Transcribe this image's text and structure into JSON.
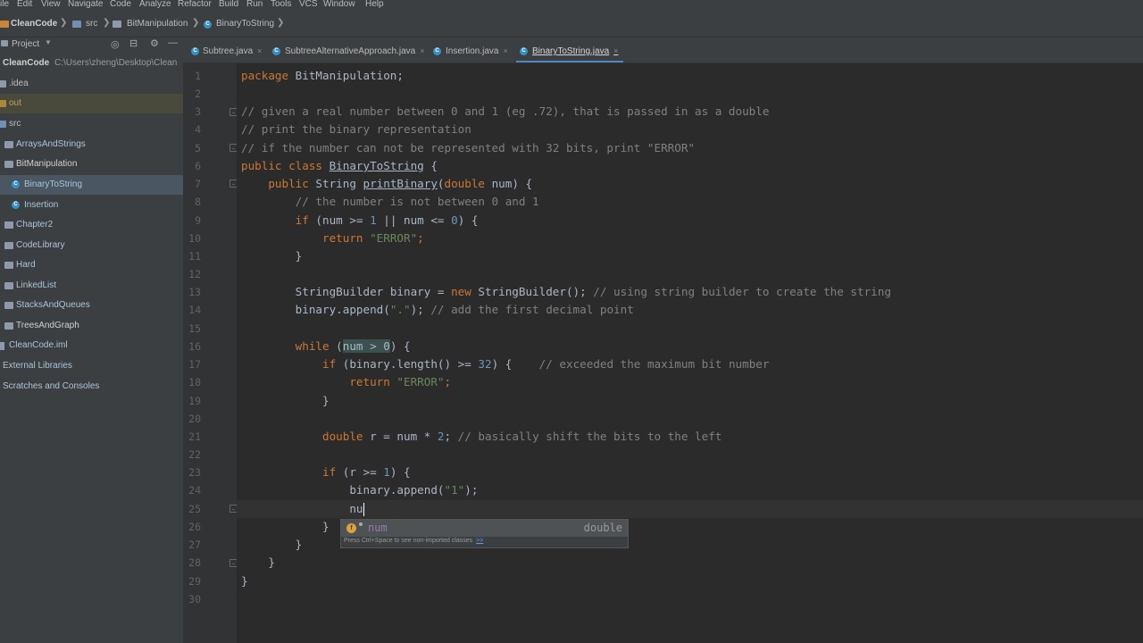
{
  "menu": [
    "ile",
    "Edit",
    "View",
    "Navigate",
    "Code",
    "Analyze",
    "Refactor",
    "Build",
    "Run",
    "Tools",
    "VCS",
    "Window",
    "Help"
  ],
  "breadcrumb": {
    "project": "CleanCode",
    "src": "src",
    "package": "BitManipulation",
    "file": "BinaryToString"
  },
  "project_panel": {
    "title": "Project",
    "root_name": "CleanCode",
    "root_path": "C:\\Users\\zheng\\Desktop\\Clean",
    "items": [
      {
        "label": ".idea"
      },
      {
        "label": "out"
      },
      {
        "label": "src"
      },
      {
        "label": "ArraysAndStrings"
      },
      {
        "label": "BitManipulation"
      },
      {
        "label": "BinaryToString"
      },
      {
        "label": "Insertion"
      },
      {
        "label": "Chapter2"
      },
      {
        "label": "CodeLibrary"
      },
      {
        "label": "Hard"
      },
      {
        "label": "LinkedList"
      },
      {
        "label": "StacksAndQueues"
      },
      {
        "label": "TreesAndGraph"
      },
      {
        "label": "CleanCode.iml"
      },
      {
        "label": "External Libraries"
      },
      {
        "label": "Scratches and Consoles"
      }
    ]
  },
  "tabs": [
    {
      "label": "Subtree.java"
    },
    {
      "label": "SubtreeAlternativeApproach.java"
    },
    {
      "label": "Insertion.java"
    },
    {
      "label": "BinaryToString.java"
    }
  ],
  "line_numbers": [
    "1",
    "2",
    "3",
    "4",
    "5",
    "6",
    "7",
    "8",
    "9",
    "10",
    "11",
    "12",
    "13",
    "14",
    "15",
    "16",
    "17",
    "18",
    "19",
    "20",
    "21",
    "22",
    "23",
    "24",
    "25",
    "26",
    "27",
    "28",
    "29",
    "30"
  ],
  "code": {
    "l1_kw": "package",
    "l1_rest": " BitManipulation;",
    "l3": "// given a real number between 0 and 1 (eg .72), that is passed in as a double",
    "l4": "// print the binary representation",
    "l5": "// if the number can not be represented with 32 bits, print \"ERROR\"",
    "l6_kw": "public class",
    "l6_name": "BinaryToString",
    "l6_rest": " {",
    "l7_kw": "public",
    "l7_a": " String ",
    "l7_name": "printBinary",
    "l7_b": "(",
    "l7_kw2": "double",
    "l7_c": " num) {",
    "l8": "// the number is not between 0 and 1",
    "l9_kw": "if",
    "l9_a": " (num >= ",
    "l9_n1": "1",
    "l9_b": " || num <= ",
    "l9_n2": "0",
    "l9_c": ") {",
    "l10_kw": "return",
    "l10_str": "\"ERROR\"",
    "l10_end": ";",
    "l11": "}",
    "l13_a": "StringBuilder binary = ",
    "l13_kw": "new",
    "l13_b": " StringBuilder(); ",
    "l13_cm": "// using string builder to create the string",
    "l14_a": "binary.append(",
    "l14_str": "\".\"",
    "l14_b": "); ",
    "l14_cm": "// add the first decimal point",
    "l16_kw": "while",
    "l16_a": " (",
    "l16_hl": "num > 0",
    "l16_b": ") {",
    "l17_kw": "if",
    "l17_a": " (binary.length() >= ",
    "l17_n": "32",
    "l17_b": ") {    ",
    "l17_cm": "// exceeded the maximum bit number",
    "l18_kw": "return",
    "l18_str": "\"ERROR\"",
    "l18_end": ";",
    "l19": "}",
    "l21_kw": "double",
    "l21_a": " r = num * ",
    "l21_n": "2",
    "l21_b": "; ",
    "l21_cm": "// basically shift the bits to the left",
    "l23_kw": "if",
    "l23_a": " (r >= ",
    "l23_n": "1",
    "l23_b": ") {",
    "l24_a": "binary.append(",
    "l24_str": "\"1\"",
    "l24_b": ");",
    "l25": "nu",
    "l26": "}",
    "l27": "}",
    "l28": "}",
    "l29": "}"
  },
  "autocomplete": {
    "suggestion": "num",
    "type": "double",
    "hint": "Press Ctrl+Space to see non-imported classes",
    "hint_link": ">>"
  }
}
